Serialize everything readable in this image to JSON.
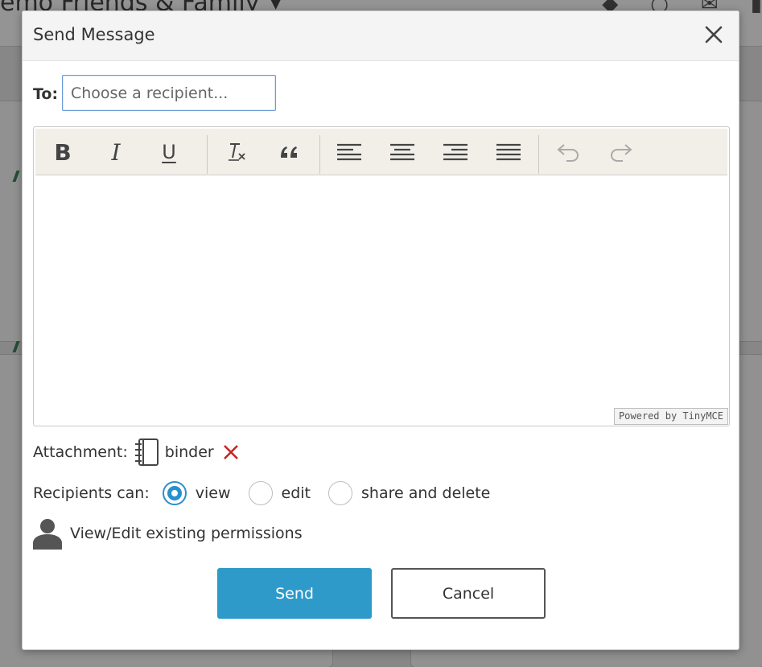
{
  "background": {
    "title": "emo   Friends & Family"
  },
  "dialog": {
    "title": "Send Message",
    "to_label": "To:",
    "to_placeholder": "Choose a recipient...",
    "toolbar": {
      "buttons": [
        "bold",
        "italic",
        "underline",
        "clear-formatting",
        "blockquote",
        "align-left",
        "align-center",
        "align-right",
        "justify",
        "undo",
        "redo"
      ],
      "bold_glyph": "B",
      "italic_glyph": "I",
      "underline_glyph": "U"
    },
    "powered_by": "Powered by TinyMCE",
    "attachment_label": "Attachment:",
    "attachment_name": "binder",
    "recipients_label": "Recipients can:",
    "permissions": [
      {
        "label": "view",
        "checked": true
      },
      {
        "label": "edit",
        "checked": false
      },
      {
        "label": "share and delete",
        "checked": false
      }
    ],
    "existing_permissions_link": "View/Edit existing permissions",
    "send_label": "Send",
    "cancel_label": "Cancel"
  },
  "colors": {
    "accent": "#2e9ac9",
    "remove": "#cc2222",
    "input_focus_border": "#6b9bd6"
  },
  "icons": {
    "close": "close-icon",
    "clear_formatting": "clear-formatting-icon",
    "blockquote": "quote-icon",
    "attachment": "binder-icon",
    "remove_attachment": "remove-icon",
    "user": "user-icon"
  }
}
